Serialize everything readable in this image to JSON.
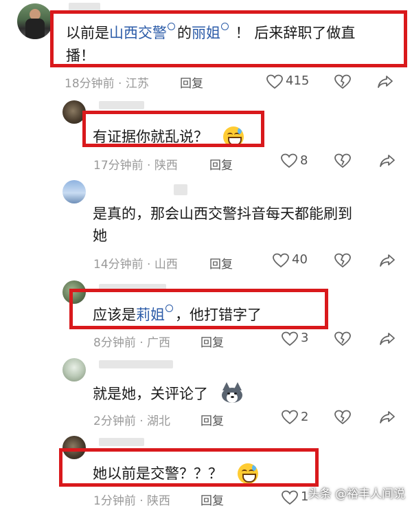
{
  "comments": [
    {
      "segments": [
        {
          "text": "以前是",
          "link": false
        },
        {
          "text": "山西交警",
          "link": true
        },
        {
          "text": "的",
          "link": false
        },
        {
          "text": "丽姐",
          "link": true
        },
        {
          "text": " ！ 后来辞职了做直",
          "link": false
        }
      ],
      "line2": "播！",
      "time": "18分钟前 · 江苏",
      "reply": "回复",
      "likes": "415"
    },
    {
      "text": "有证据你就乱说？",
      "time": "17分钟前 · 陕西",
      "reply": "回复",
      "likes": "8",
      "emoji": "grin-sweat-emoji"
    },
    {
      "line1": "是真的，那会山西交警抖音每天都能刷到",
      "line2": "她",
      "time": "14分钟前 · 山西",
      "reply": "回复",
      "likes": "40"
    },
    {
      "segments": [
        {
          "text": "应该是",
          "link": false
        },
        {
          "text": "莉姐",
          "link": true
        },
        {
          "text": "，他打错字了",
          "link": false
        }
      ],
      "time": "8分钟前 · 广西",
      "reply": "回复",
      "likes": "3"
    },
    {
      "text": "就是她，关评论了",
      "time": "2分钟前 · 湖北",
      "reply": "回复",
      "likes": "2",
      "emoji": "husky-dog-emoji"
    },
    {
      "text": "她以前是交警？？？",
      "time": "1分钟前 · 陕西",
      "reply": "回复",
      "likes": "1",
      "emoji": "grin-sweat-emoji"
    }
  ],
  "watermark": "头条 @裕丰人间说",
  "colors": {
    "link": "#2b5ba8",
    "highlight_box": "#d9191c",
    "meta": "#999999"
  },
  "icons": [
    "heart-outline-icon",
    "broken-heart-icon",
    "share-arrow-icon",
    "search-icon"
  ]
}
